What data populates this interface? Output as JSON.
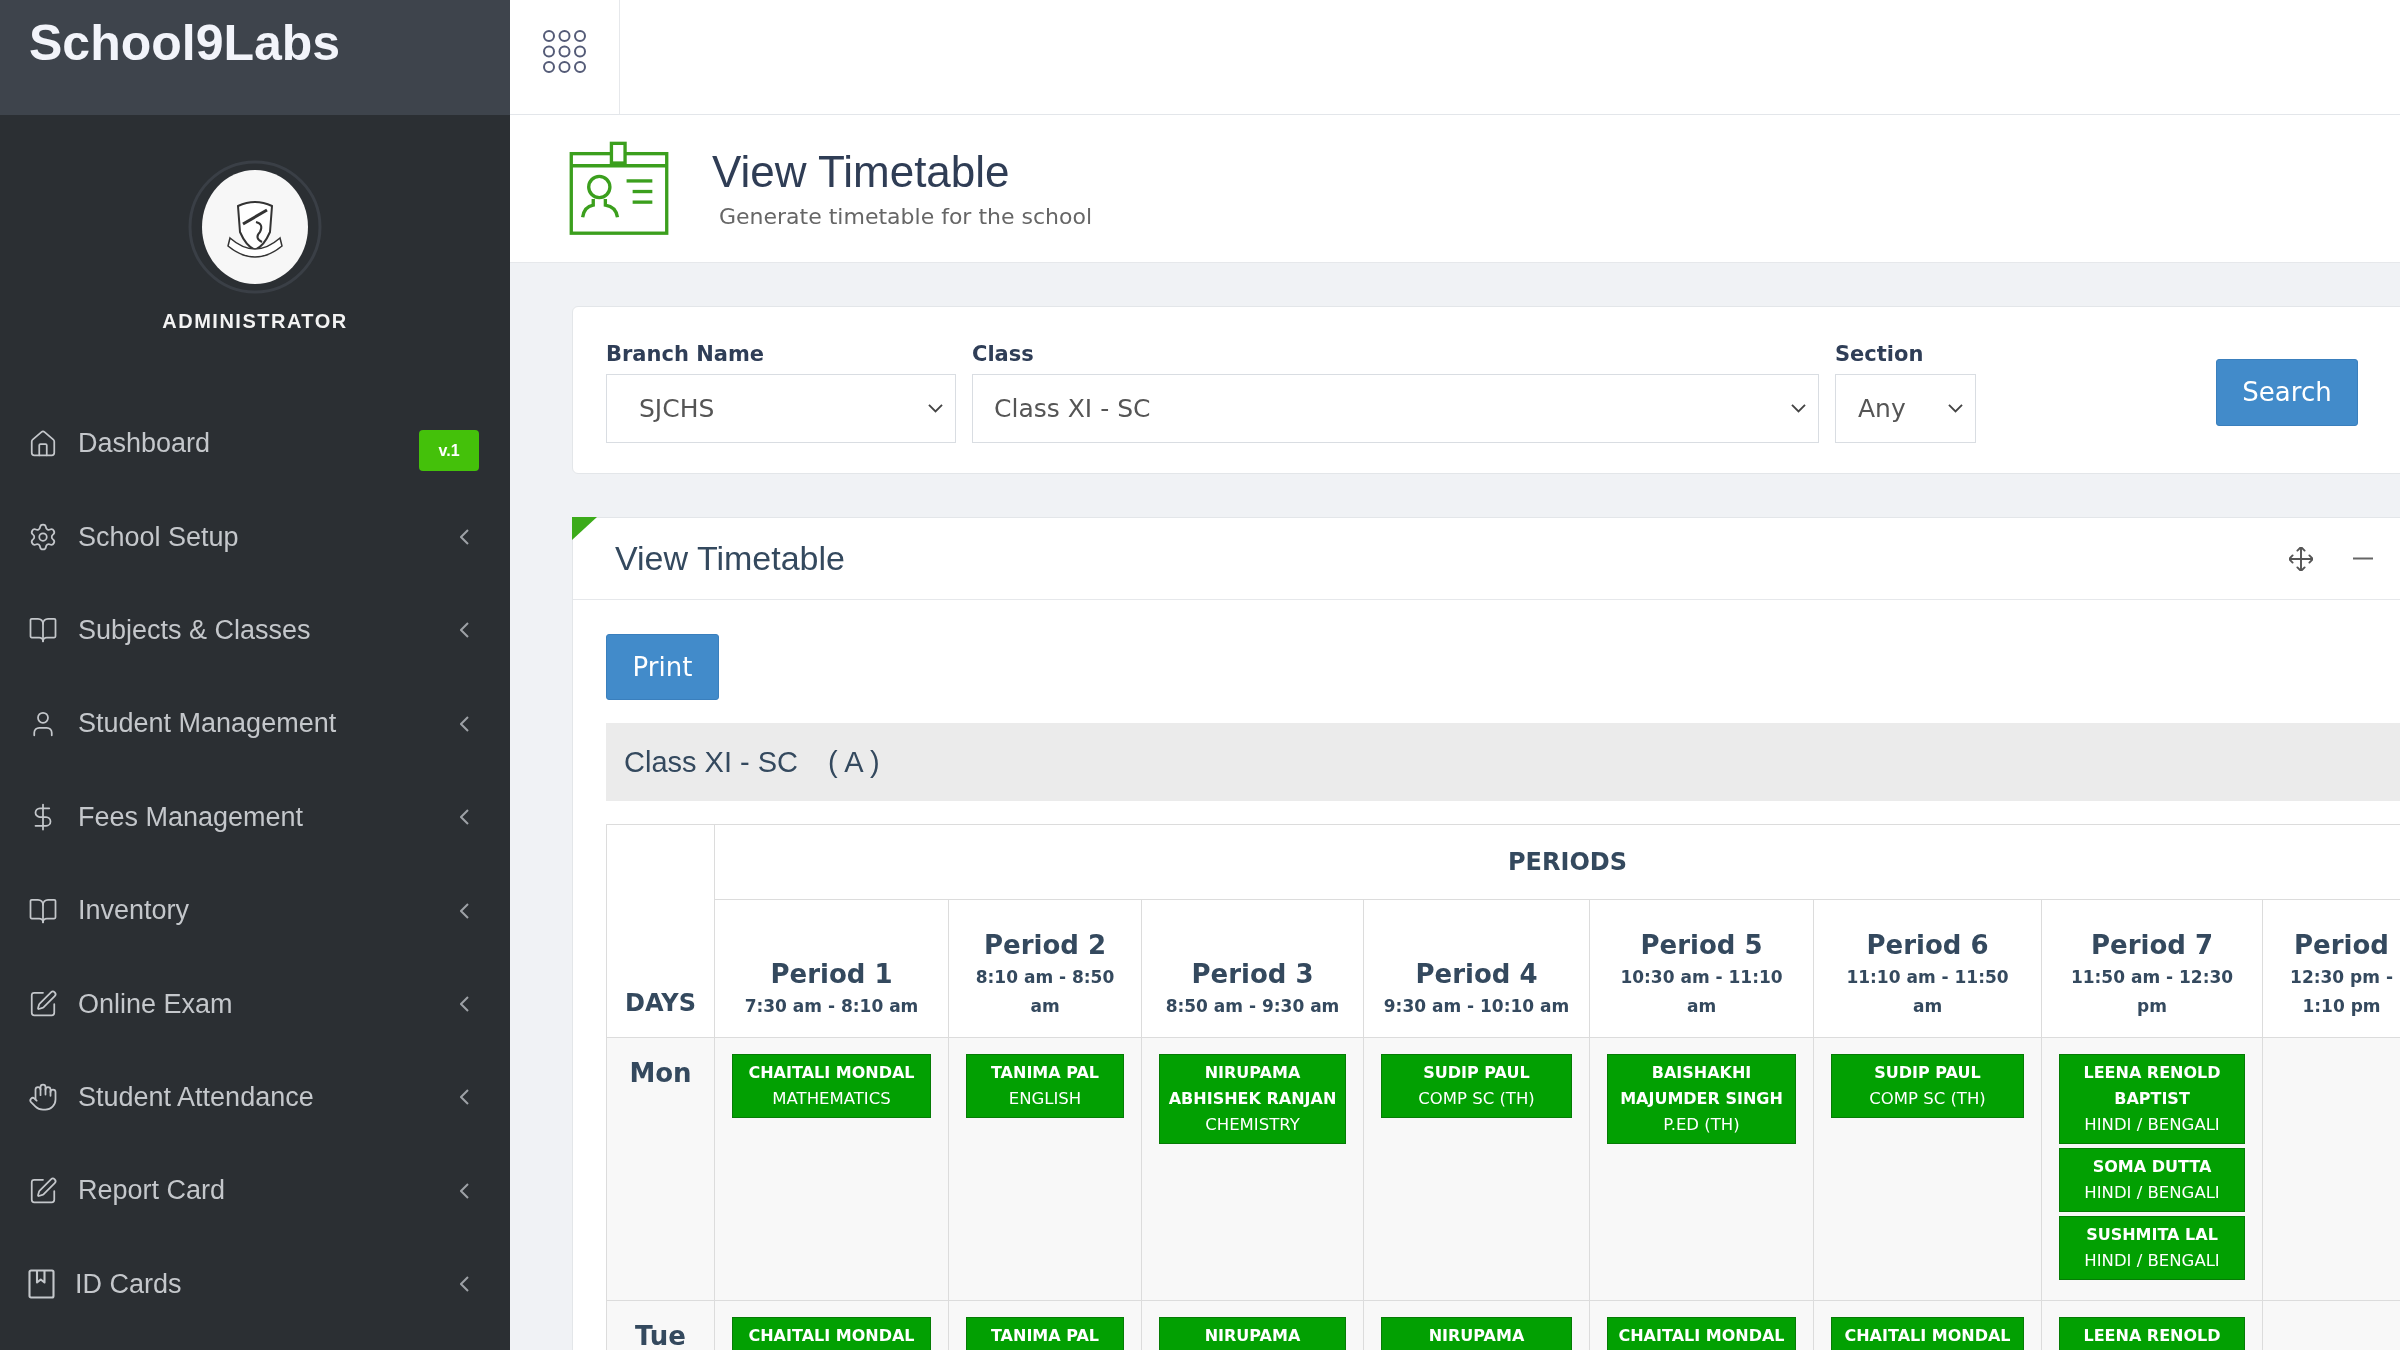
{
  "brand": {
    "name": "School9Labs"
  },
  "profile": {
    "role": "ADMINISTRATOR"
  },
  "sidebar": {
    "items": [
      {
        "label": "Dashboard",
        "kind": "link",
        "badge": "v.1"
      },
      {
        "label": "School Setup",
        "kind": "submenu",
        "expanded": false
      },
      {
        "label": "Subjects & Classes",
        "kind": "submenu",
        "expanded": false
      },
      {
        "label": "Student Management",
        "kind": "submenu",
        "expanded": false
      },
      {
        "label": "Fees Management",
        "kind": "submenu",
        "expanded": false
      },
      {
        "label": "Inventory",
        "kind": "submenu",
        "expanded": false
      },
      {
        "label": "Online Exam",
        "kind": "submenu",
        "expanded": false
      },
      {
        "label": "Student Attendance",
        "kind": "submenu",
        "expanded": false
      },
      {
        "label": "Report Card",
        "kind": "submenu",
        "expanded": false
      },
      {
        "label": "ID Cards",
        "kind": "submenu",
        "expanded": false
      }
    ]
  },
  "page_header": {
    "title": "View Timetable",
    "subtitle": "Generate timetable for the school"
  },
  "filters": {
    "fields": [
      {
        "label": "Branch Name",
        "value": "SJCHS"
      },
      {
        "label": "Class",
        "value": "Class XI - SC"
      },
      {
        "label": "Section",
        "value": "Any"
      }
    ],
    "search_button": "Search"
  },
  "timetable_panel": {
    "title": "View Timetable",
    "print_button": "Print",
    "class_bar": {
      "class_name": "Class XI - SC",
      "section": "( A )"
    },
    "table": {
      "days_heading": "DAYS",
      "periods_heading": "PERIODS",
      "periods": [
        {
          "name": "Period 1",
          "time": "7:30 am - 8:10 am"
        },
        {
          "name": "Period 2",
          "time": "8:10 am - 8:50 am"
        },
        {
          "name": "Period 3",
          "time": "8:50 am - 9:30 am"
        },
        {
          "name": "Period 4",
          "time": "9:30 am - 10:10 am"
        },
        {
          "name": "Period 5",
          "time": "10:30 am - 11:10 am"
        },
        {
          "name": "Period 6",
          "time": "11:10 am - 11:50 am"
        },
        {
          "name": "Period 7",
          "time": "11:50 am - 12:30 pm"
        },
        {
          "name": "Period",
          "time": "12:30 pm - 1:10 pm"
        }
      ],
      "rows": [
        {
          "day": "Mon",
          "cells": [
            {
              "entries": [
                {
                  "teacher": "CHAITALI MONDAL",
                  "subject": "MATHEMATICS"
                }
              ]
            },
            {
              "entries": [
                {
                  "teacher": "TANIMA PAL",
                  "subject": "ENGLISH"
                }
              ]
            },
            {
              "entries": [
                {
                  "teacher": "NIRUPAMA ABHISHEK RANJAN",
                  "subject": "CHEMISTRY"
                }
              ]
            },
            {
              "entries": [
                {
                  "teacher": "SUDIP PAUL",
                  "subject": "COMP SC (TH)"
                }
              ]
            },
            {
              "entries": [
                {
                  "teacher": "BAISHAKHI MAJUMDER SINGH",
                  "subject": "P.ED (TH)"
                }
              ]
            },
            {
              "entries": [
                {
                  "teacher": "SUDIP PAUL",
                  "subject": "COMP SC (TH)"
                }
              ]
            },
            {
              "entries": [
                {
                  "teacher": "LEENA RENOLD BAPTIST",
                  "subject": "HINDI / BENGALI"
                },
                {
                  "teacher": "SOMA DUTTA",
                  "subject": "HINDI / BENGALI"
                },
                {
                  "teacher": "SUSHMITA LAL",
                  "subject": "HINDI / BENGALI"
                }
              ]
            }
          ]
        },
        {
          "day": "Tue",
          "cells": [
            {
              "entries": [
                {
                  "teacher": "CHAITALI MONDAL"
                }
              ]
            },
            {
              "entries": [
                {
                  "teacher": "TANIMA PAL"
                }
              ]
            },
            {
              "entries": [
                {
                  "teacher": "NIRUPAMA"
                }
              ]
            },
            {
              "entries": [
                {
                  "teacher": "NIRUPAMA"
                }
              ]
            },
            {
              "entries": [
                {
                  "teacher": "CHAITALI MONDAL"
                }
              ]
            },
            {
              "entries": [
                {
                  "teacher": "CHAITALI MONDAL"
                }
              ]
            },
            {
              "entries": [
                {
                  "teacher": "LEENA RENOLD"
                }
              ]
            }
          ]
        }
      ]
    }
  }
}
